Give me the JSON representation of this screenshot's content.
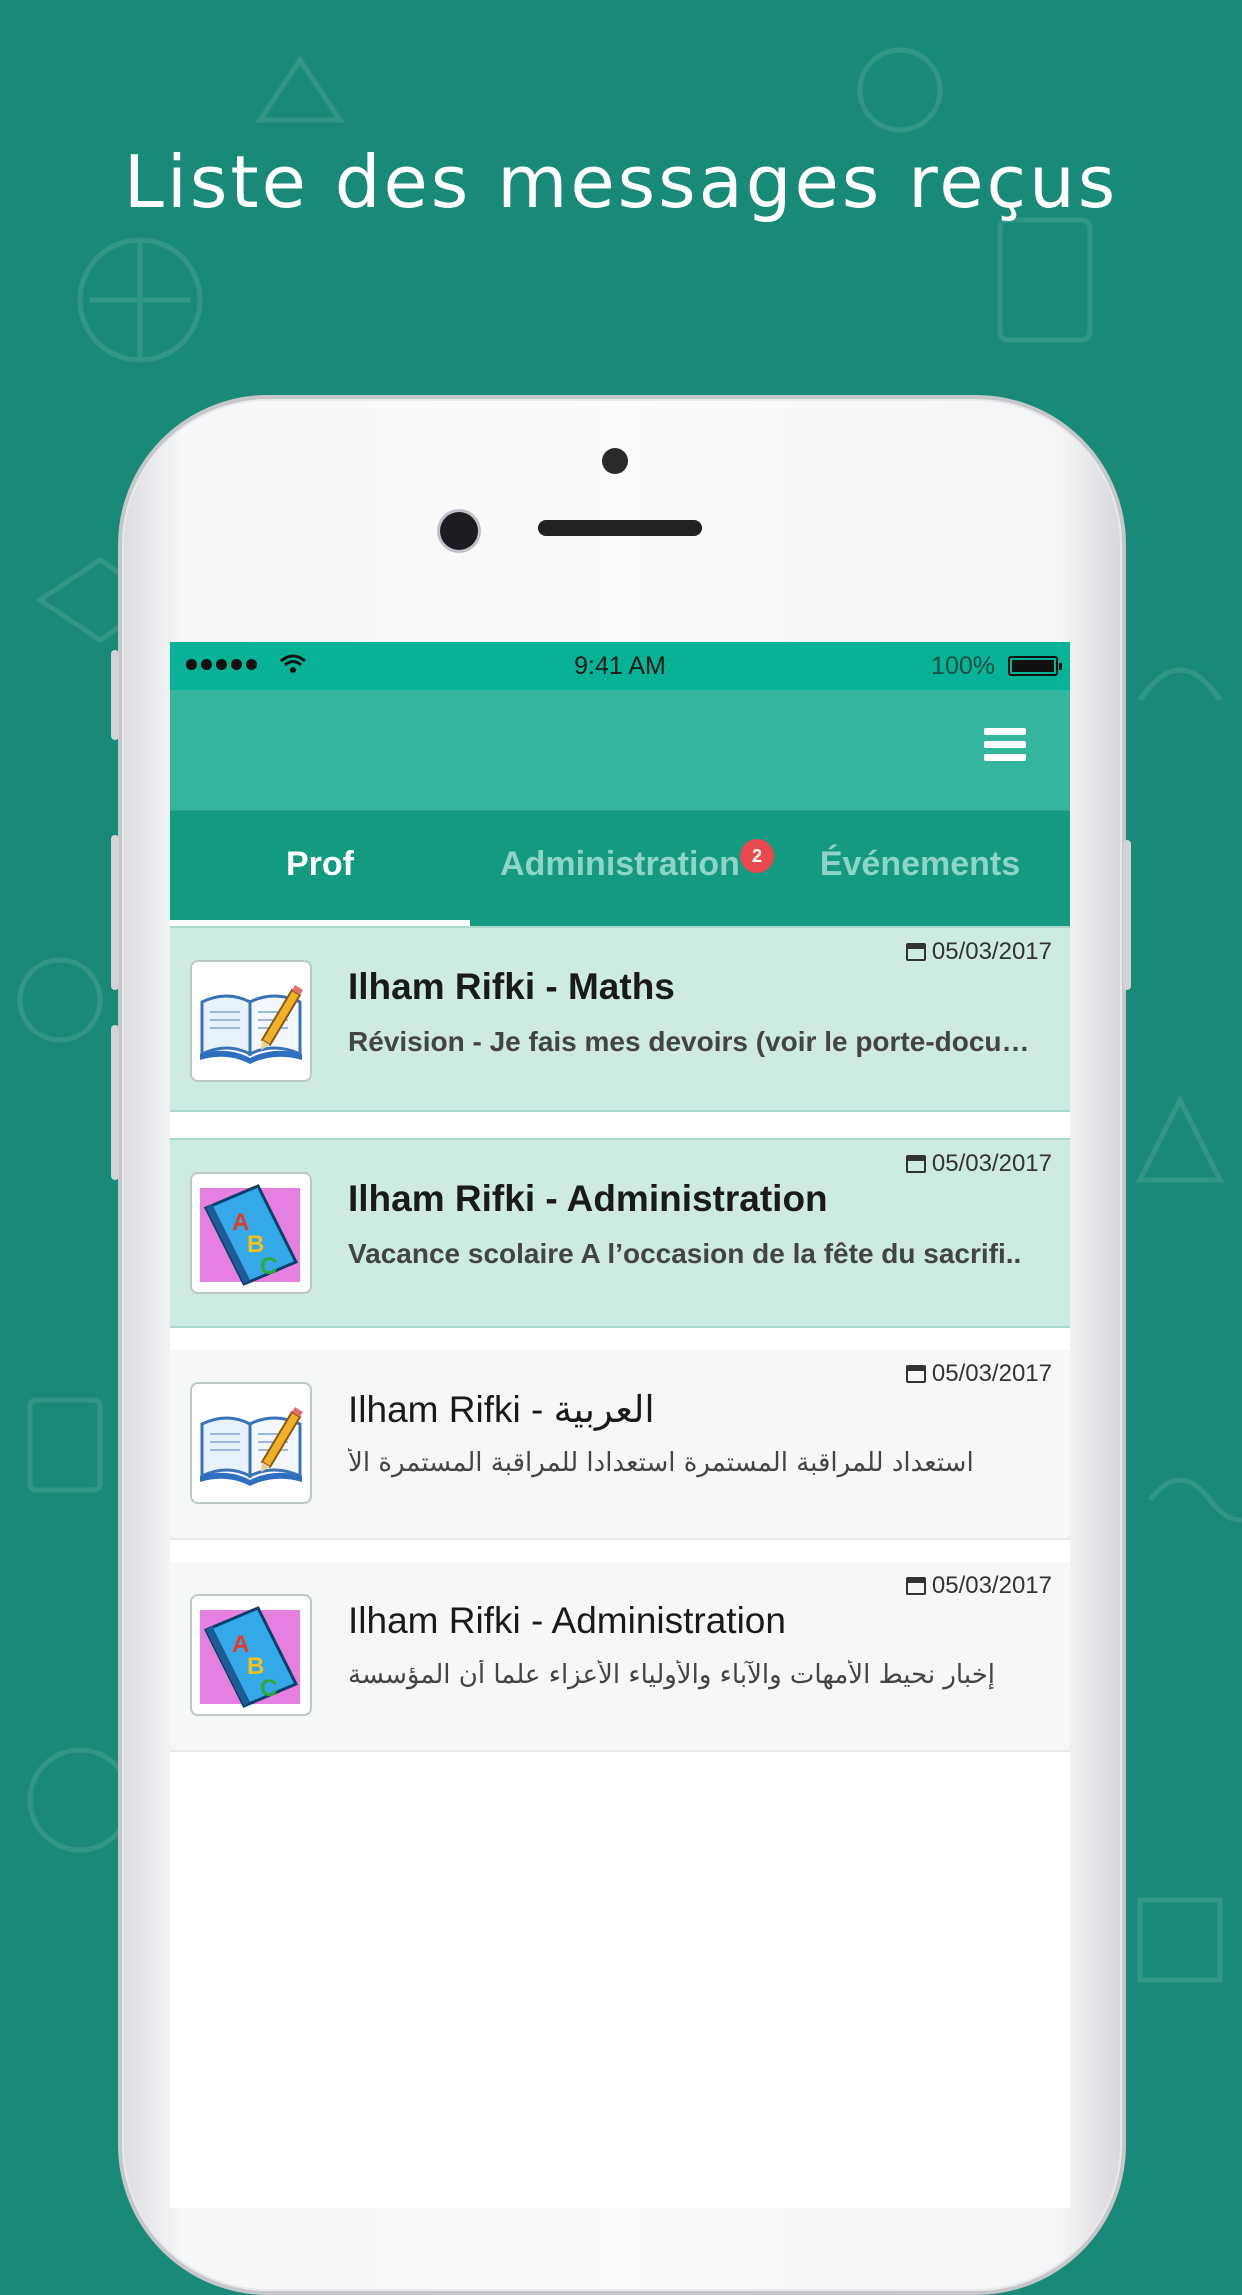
{
  "headline": "Liste des messages reçus",
  "status_bar": {
    "time": "9:41 AM",
    "battery": "100%"
  },
  "header": {
    "menu_icon": "hamburger-menu-icon"
  },
  "tabs": [
    {
      "label": "Prof",
      "active": true
    },
    {
      "label": "Administration",
      "active": false,
      "badge": "2"
    },
    {
      "label": "Événements",
      "active": false
    }
  ],
  "messages": [
    {
      "date": "05/03/2017",
      "title": "Ilham Rifki - Maths",
      "preview": "Révision - Je fais mes devoirs (voir le porte-docu…",
      "icon": "open-book-icon",
      "unread": true
    },
    {
      "date": "05/03/2017",
      "title": "Ilham Rifki - Administration",
      "preview": "Vacance scolaire A l’occasion de la fête du sacrifi..",
      "icon": "abc-book-icon",
      "unread": true
    },
    {
      "date": "05/03/2017",
      "title": "Ilham Rifki - العربية",
      "preview": "استعداد للمراقبة المستمرة استعدادا للمراقبة المستمرة الأ",
      "icon": "open-book-icon",
      "unread": false
    },
    {
      "date": "05/03/2017",
      "title": "Ilham Rifki - Administration",
      "preview": "إخبار نحيط الأمهات والآباء والأولياء الأعزاء علما أن المؤسسة",
      "icon": "abc-book-icon",
      "unread": false
    }
  ],
  "colors": {
    "background": "#1a8a78",
    "status_bar": "#08b296",
    "header": "#35b49e",
    "tabs": "#149a80",
    "unread_row": "#cdebe3",
    "badge": "#e84a4f"
  }
}
